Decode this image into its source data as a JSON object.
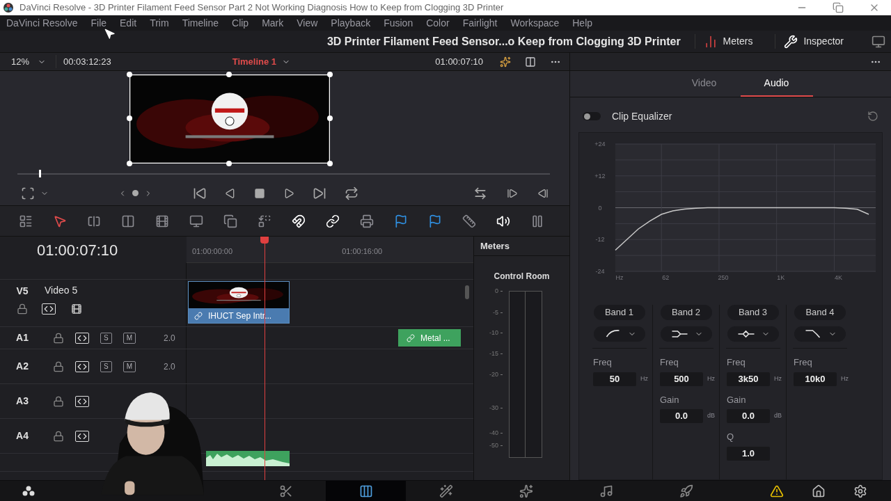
{
  "window": {
    "title": "DaVinci Resolve - 3D Printer Filament Feed Sensor Part 2 Not Working Diagnosis How to Keep from Clogging 3D Printer"
  },
  "menu": [
    "DaVinci Resolve",
    "File",
    "Edit",
    "Trim",
    "Timeline",
    "Clip",
    "Mark",
    "View",
    "Playback",
    "Fusion",
    "Color",
    "Fairlight",
    "Workspace",
    "Help"
  ],
  "project_title": "3D Printer Filament Feed Sensor...o Keep from Clogging 3D Printer",
  "header_buttons": [
    {
      "label": "Meters",
      "kind": "meters"
    },
    {
      "label": "Inspector",
      "kind": "inspector"
    }
  ],
  "viewer": {
    "zoom": "12%",
    "source_timecode": "00:03:12:23",
    "timeline_name": "Timeline 1",
    "timecode": "01:00:07:10",
    "scrub": {
      "level": 0.04
    }
  },
  "timeline": {
    "timecode": "01:00:07:10",
    "ruler": [
      "01:00:00:00",
      "01:00:16:00"
    ],
    "tracks": [
      {
        "kind": "partial"
      },
      {
        "kind": "video",
        "id": "V5",
        "name": "Video 5",
        "clips": [
          {
            "kind": "video",
            "label": "IHUCT Sep Intr..."
          }
        ]
      },
      {
        "kind": "audio",
        "id": "A1",
        "solo": "S",
        "mute": "M",
        "channels": "2.0",
        "clips": [
          {
            "kind": "audio",
            "label": "Metal ..."
          }
        ]
      },
      {
        "kind": "audio",
        "id": "A2",
        "solo": "S",
        "mute": "M",
        "channels": "2.0"
      },
      {
        "kind": "audio",
        "id": "A3"
      },
      {
        "kind": "audio",
        "id": "A4"
      },
      {
        "kind": "partial",
        "clips": [
          {
            "kind": "waveform"
          }
        ]
      }
    ]
  },
  "meters": {
    "title": "Meters",
    "control_room": "Control Room",
    "scale": [
      "0",
      "-5",
      "-10",
      "-15",
      "-20",
      "-30",
      "-40",
      "-50"
    ]
  },
  "inspector": {
    "tabs": [
      {
        "label": "Video",
        "selected": false
      },
      {
        "label": "Audio",
        "selected": true
      }
    ],
    "clip_equalizer": {
      "label": "Clip Equalizer",
      "on": false
    },
    "eq": {
      "chart_data": {
        "type": "line",
        "categories": [
          "Hz",
          null,
          null,
          null,
          "62",
          null,
          null,
          null,
          null,
          "250",
          null,
          null,
          null,
          null,
          "1K",
          null,
          null,
          null,
          null,
          "4K",
          null,
          null,
          null
        ],
        "ylim": [
          -24,
          24
        ],
        "series": [
          {
            "color": "#c8c8c8",
            "values": [
              -16,
              -12,
              -8,
              -5,
              -2.5,
              -1.2,
              -0.5,
              -0.2,
              0,
              0,
              0,
              0,
              0,
              0,
              0,
              0,
              0,
              0,
              0,
              0,
              -0.2,
              -0.6,
              -2.5
            ]
          }
        ],
        "yticks": [
          {
            "value": 24,
            "label": "+24"
          },
          {
            "value": 12,
            "label": "+12"
          },
          {
            "value": 0,
            "label": "0"
          },
          {
            "value": -12,
            "label": "-12"
          },
          {
            "value": -24,
            "label": "-24"
          }
        ]
      }
    },
    "bands": [
      {
        "label": "Band 1",
        "kind": "low_cut",
        "params": [
          {
            "label": "Freq",
            "value": "50",
            "unit": "Hz"
          }
        ]
      },
      {
        "label": "Band 2",
        "kind": "low_shelf",
        "params": [
          {
            "label": "Freq",
            "value": "500",
            "unit": "Hz"
          },
          {
            "label": "Gain",
            "value": "0.0",
            "unit": "dB"
          }
        ]
      },
      {
        "label": "Band 3",
        "kind": "bell",
        "params": [
          {
            "label": "Freq",
            "value": "3k50",
            "unit": "Hz"
          },
          {
            "label": "Gain",
            "value": "0.0",
            "unit": "dB"
          },
          {
            "label": "Q",
            "value": "1.0"
          }
        ]
      },
      {
        "label": "Band 4",
        "kind": "high_cut",
        "params": [
          {
            "label": "Freq",
            "value": "10k0",
            "unit": "Hz"
          }
        ]
      }
    ]
  },
  "pages": [
    {
      "kind": "cut",
      "selected": false
    },
    {
      "kind": "edit",
      "selected": true
    },
    {
      "kind": "fusion",
      "selected": false
    },
    {
      "kind": "color",
      "selected": false
    },
    {
      "kind": "fairlight",
      "selected": false
    },
    {
      "kind": "deliver",
      "selected": false
    }
  ],
  "status_icons": [
    {
      "kind": "warning"
    },
    {
      "kind": "home"
    },
    {
      "kind": "settings"
    }
  ]
}
